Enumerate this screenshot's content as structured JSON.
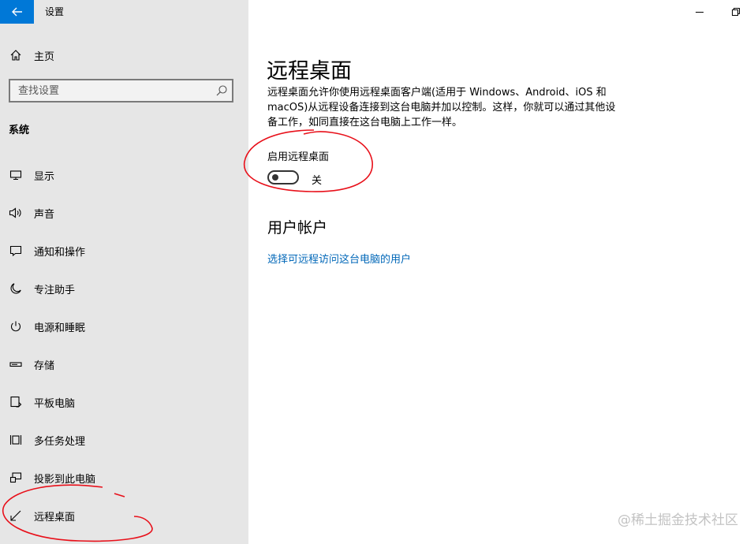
{
  "app": {
    "title": "设置",
    "back_icon": "back-arrow-icon",
    "accent_color": "#0078d7"
  },
  "sidebar": {
    "home": {
      "label": "主页",
      "icon": "home-icon"
    },
    "search": {
      "placeholder": "查找设置",
      "value": "",
      "icon": "search-icon"
    },
    "section_title": "系统",
    "items": [
      {
        "label": "显示",
        "icon": "monitor-icon"
      },
      {
        "label": "声音",
        "icon": "speaker-icon"
      },
      {
        "label": "通知和操作",
        "icon": "notification-icon"
      },
      {
        "label": "专注助手",
        "icon": "moon-icon"
      },
      {
        "label": "电源和睡眠",
        "icon": "power-icon"
      },
      {
        "label": "存储",
        "icon": "storage-icon"
      },
      {
        "label": "平板电脑",
        "icon": "tablet-icon"
      },
      {
        "label": "多任务处理",
        "icon": "multitasking-icon"
      },
      {
        "label": "投影到此电脑",
        "icon": "project-icon"
      },
      {
        "label": "远程桌面",
        "icon": "remote-desktop-icon",
        "selected": true
      }
    ]
  },
  "window_controls": {
    "minimize_icon": "minimize-icon",
    "restore_icon": "restore-icon"
  },
  "main": {
    "title": "远程桌面",
    "description": "远程桌面允许你使用远程桌面客户端(适用于 Windows、Android、iOS 和 macOS)从远程设备连接到这台电脑并加以控制。这样，你就可以通过其他设备工作，如同直接在这台电脑上工作一样。",
    "toggle": {
      "label": "启用远程桌面",
      "state_text": "关",
      "on": false
    },
    "user_accounts": {
      "heading": "用户帐户",
      "link": "选择可远程访问这台电脑的用户",
      "link_color": "#0067b8"
    }
  },
  "watermark": "@稀土掘金技术社区"
}
